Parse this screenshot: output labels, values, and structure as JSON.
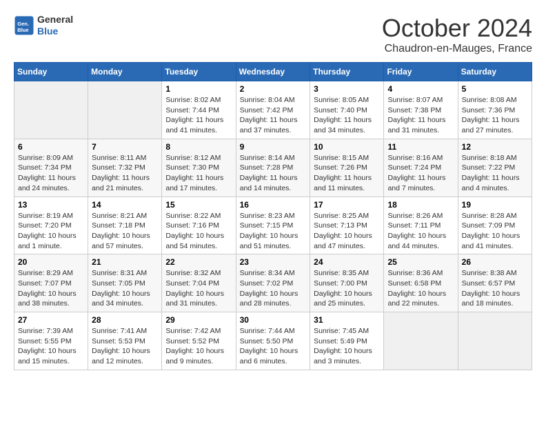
{
  "header": {
    "logo_general": "General",
    "logo_blue": "Blue",
    "month_title": "October 2024",
    "location": "Chaudron-en-Mauges, France"
  },
  "weekdays": [
    "Sunday",
    "Monday",
    "Tuesday",
    "Wednesday",
    "Thursday",
    "Friday",
    "Saturday"
  ],
  "weeks": [
    [
      {
        "day": "",
        "info": ""
      },
      {
        "day": "",
        "info": ""
      },
      {
        "day": "1",
        "info": "Sunrise: 8:02 AM\nSunset: 7:44 PM\nDaylight: 11 hours and 41 minutes."
      },
      {
        "day": "2",
        "info": "Sunrise: 8:04 AM\nSunset: 7:42 PM\nDaylight: 11 hours and 37 minutes."
      },
      {
        "day": "3",
        "info": "Sunrise: 8:05 AM\nSunset: 7:40 PM\nDaylight: 11 hours and 34 minutes."
      },
      {
        "day": "4",
        "info": "Sunrise: 8:07 AM\nSunset: 7:38 PM\nDaylight: 11 hours and 31 minutes."
      },
      {
        "day": "5",
        "info": "Sunrise: 8:08 AM\nSunset: 7:36 PM\nDaylight: 11 hours and 27 minutes."
      }
    ],
    [
      {
        "day": "6",
        "info": "Sunrise: 8:09 AM\nSunset: 7:34 PM\nDaylight: 11 hours and 24 minutes."
      },
      {
        "day": "7",
        "info": "Sunrise: 8:11 AM\nSunset: 7:32 PM\nDaylight: 11 hours and 21 minutes."
      },
      {
        "day": "8",
        "info": "Sunrise: 8:12 AM\nSunset: 7:30 PM\nDaylight: 11 hours and 17 minutes."
      },
      {
        "day": "9",
        "info": "Sunrise: 8:14 AM\nSunset: 7:28 PM\nDaylight: 11 hours and 14 minutes."
      },
      {
        "day": "10",
        "info": "Sunrise: 8:15 AM\nSunset: 7:26 PM\nDaylight: 11 hours and 11 minutes."
      },
      {
        "day": "11",
        "info": "Sunrise: 8:16 AM\nSunset: 7:24 PM\nDaylight: 11 hours and 7 minutes."
      },
      {
        "day": "12",
        "info": "Sunrise: 8:18 AM\nSunset: 7:22 PM\nDaylight: 11 hours and 4 minutes."
      }
    ],
    [
      {
        "day": "13",
        "info": "Sunrise: 8:19 AM\nSunset: 7:20 PM\nDaylight: 10 hours and 1 minute."
      },
      {
        "day": "14",
        "info": "Sunrise: 8:21 AM\nSunset: 7:18 PM\nDaylight: 10 hours and 57 minutes."
      },
      {
        "day": "15",
        "info": "Sunrise: 8:22 AM\nSunset: 7:16 PM\nDaylight: 10 hours and 54 minutes."
      },
      {
        "day": "16",
        "info": "Sunrise: 8:23 AM\nSunset: 7:15 PM\nDaylight: 10 hours and 51 minutes."
      },
      {
        "day": "17",
        "info": "Sunrise: 8:25 AM\nSunset: 7:13 PM\nDaylight: 10 hours and 47 minutes."
      },
      {
        "day": "18",
        "info": "Sunrise: 8:26 AM\nSunset: 7:11 PM\nDaylight: 10 hours and 44 minutes."
      },
      {
        "day": "19",
        "info": "Sunrise: 8:28 AM\nSunset: 7:09 PM\nDaylight: 10 hours and 41 minutes."
      }
    ],
    [
      {
        "day": "20",
        "info": "Sunrise: 8:29 AM\nSunset: 7:07 PM\nDaylight: 10 hours and 38 minutes."
      },
      {
        "day": "21",
        "info": "Sunrise: 8:31 AM\nSunset: 7:05 PM\nDaylight: 10 hours and 34 minutes."
      },
      {
        "day": "22",
        "info": "Sunrise: 8:32 AM\nSunset: 7:04 PM\nDaylight: 10 hours and 31 minutes."
      },
      {
        "day": "23",
        "info": "Sunrise: 8:34 AM\nSunset: 7:02 PM\nDaylight: 10 hours and 28 minutes."
      },
      {
        "day": "24",
        "info": "Sunrise: 8:35 AM\nSunset: 7:00 PM\nDaylight: 10 hours and 25 minutes."
      },
      {
        "day": "25",
        "info": "Sunrise: 8:36 AM\nSunset: 6:58 PM\nDaylight: 10 hours and 22 minutes."
      },
      {
        "day": "26",
        "info": "Sunrise: 8:38 AM\nSunset: 6:57 PM\nDaylight: 10 hours and 18 minutes."
      }
    ],
    [
      {
        "day": "27",
        "info": "Sunrise: 7:39 AM\nSunset: 5:55 PM\nDaylight: 10 hours and 15 minutes."
      },
      {
        "day": "28",
        "info": "Sunrise: 7:41 AM\nSunset: 5:53 PM\nDaylight: 10 hours and 12 minutes."
      },
      {
        "day": "29",
        "info": "Sunrise: 7:42 AM\nSunset: 5:52 PM\nDaylight: 10 hours and 9 minutes."
      },
      {
        "day": "30",
        "info": "Sunrise: 7:44 AM\nSunset: 5:50 PM\nDaylight: 10 hours and 6 minutes."
      },
      {
        "day": "31",
        "info": "Sunrise: 7:45 AM\nSunset: 5:49 PM\nDaylight: 10 hours and 3 minutes."
      },
      {
        "day": "",
        "info": ""
      },
      {
        "day": "",
        "info": ""
      }
    ]
  ]
}
